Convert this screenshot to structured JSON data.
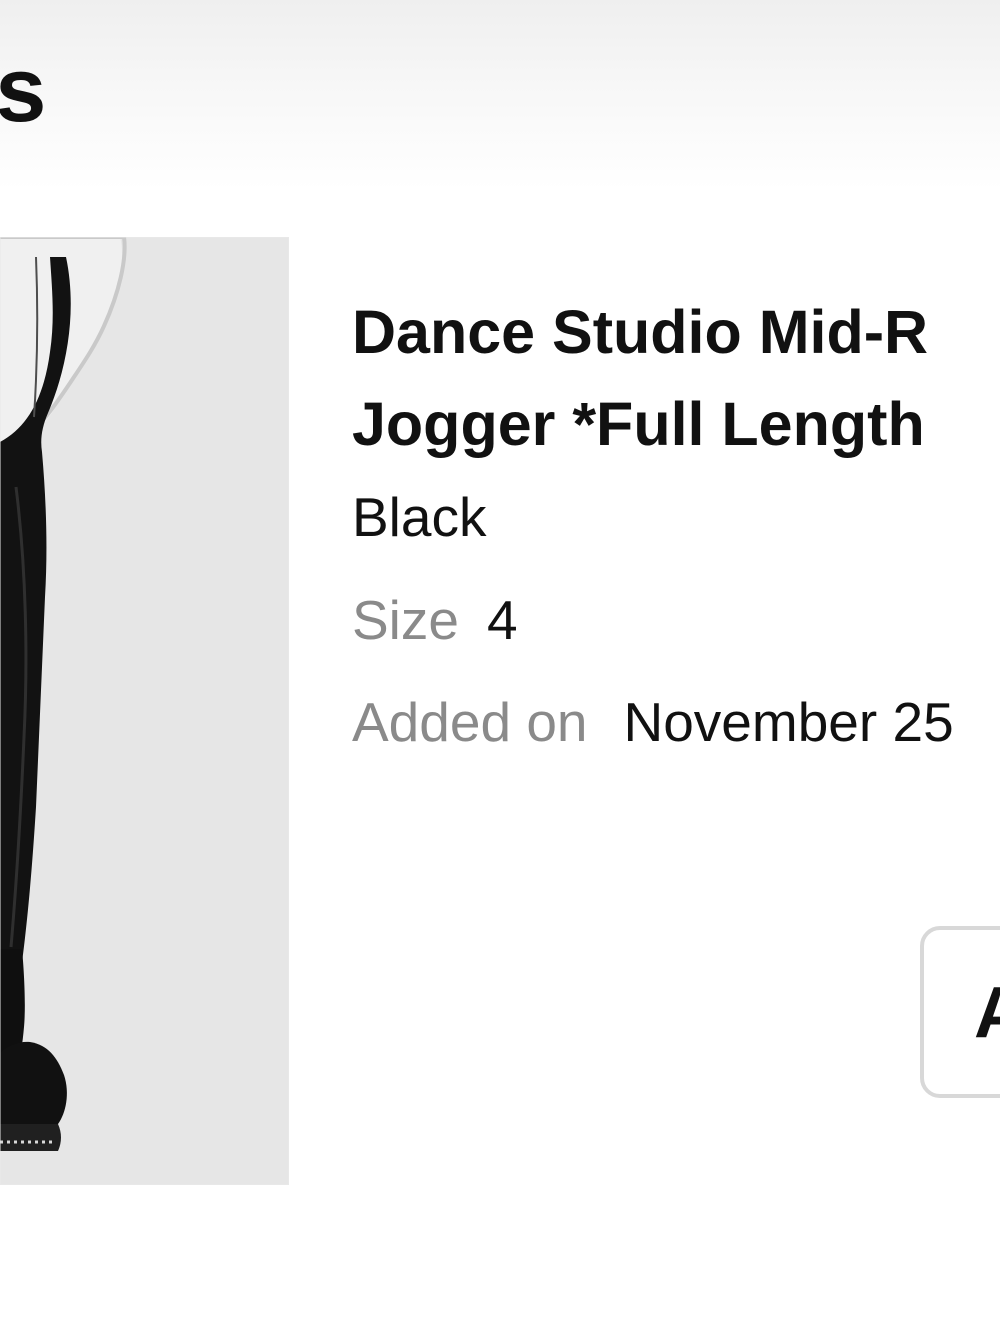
{
  "header": {
    "title": "ails"
  },
  "product": {
    "image_icon": "product-photo",
    "name_line1": "Dance Studio Mid-R",
    "name_line2": "Jogger *Full Length",
    "color": "Black",
    "size_label": "Size",
    "size_value": "4",
    "added_label": "Added on",
    "added_value": "November 25"
  },
  "actions": {
    "button_label": "A"
  },
  "colors": {
    "background": "#ffffff",
    "image_background": "#e6e6e6",
    "text_primary": "#111111",
    "text_secondary": "#8a8a8a",
    "button_border": "#d8d8d8"
  }
}
